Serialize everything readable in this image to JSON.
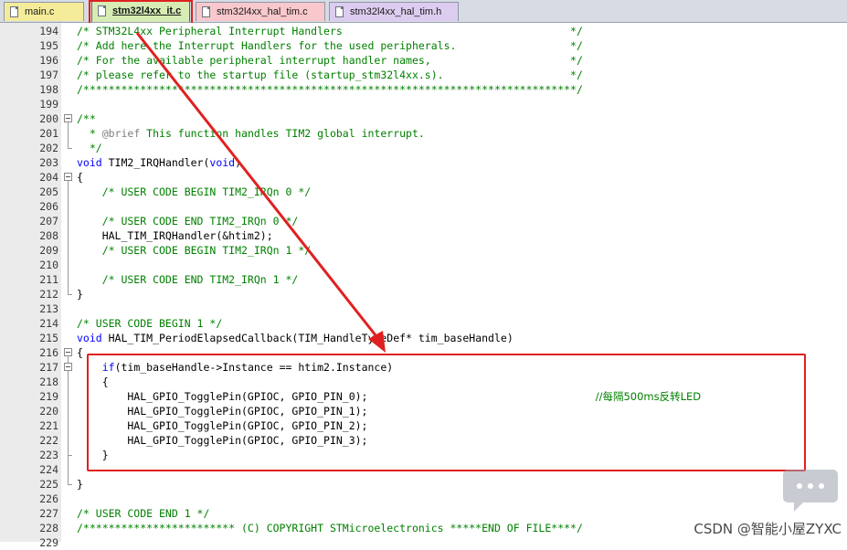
{
  "tabs": [
    {
      "label": "main.c",
      "color": "#f5ec9a",
      "active": false
    },
    {
      "label": "stm32l4xx_it.c",
      "color": "#d7ecb4",
      "active": true
    },
    {
      "label": "stm32l4xx_hal_tim.c",
      "color": "#f8c8cc",
      "active": false
    },
    {
      "label": "stm32l4xx_hal_tim.h",
      "color": "#dccdf0",
      "active": false
    }
  ],
  "lines": [
    {
      "n": "194",
      "segs": [
        {
          "t": "/* STM32L4xx Peripheral Interrupt Handlers                                    */",
          "c": "comment"
        }
      ]
    },
    {
      "n": "195",
      "segs": [
        {
          "t": "/* Add here the Interrupt Handlers for the used peripherals.                  */",
          "c": "comment"
        }
      ]
    },
    {
      "n": "196",
      "segs": [
        {
          "t": "/* For the available peripheral interrupt handler names,                      */",
          "c": "comment"
        }
      ]
    },
    {
      "n": "197",
      "segs": [
        {
          "t": "/* please refer to the startup file (startup_stm32l4xx.s).                    */",
          "c": "comment"
        }
      ]
    },
    {
      "n": "198",
      "segs": [
        {
          "t": "/******************************************************************************/",
          "c": "comment"
        }
      ]
    },
    {
      "n": "199",
      "segs": []
    },
    {
      "n": "200",
      "segs": [
        {
          "t": "/**",
          "c": "comment"
        }
      ]
    },
    {
      "n": "201",
      "segs": [
        {
          "t": "  * ",
          "c": "comment"
        },
        {
          "t": "@brief",
          "c": "brief"
        },
        {
          "t": " This function handles TIM2 global interrupt.",
          "c": "comment"
        }
      ]
    },
    {
      "n": "202",
      "segs": [
        {
          "t": "  */",
          "c": "comment"
        }
      ]
    },
    {
      "n": "203",
      "segs": [
        {
          "t": "void",
          "c": "kw"
        },
        {
          "t": " TIM2_IRQHandler(",
          "c": "plain"
        },
        {
          "t": "void",
          "c": "kw"
        },
        {
          "t": ")",
          "c": "plain"
        }
      ]
    },
    {
      "n": "204",
      "segs": [
        {
          "t": "{",
          "c": "plain"
        }
      ]
    },
    {
      "n": "205",
      "segs": [
        {
          "t": "    /* USER CODE BEGIN TIM2_IRQn 0 */",
          "c": "comment"
        }
      ]
    },
    {
      "n": "206",
      "segs": []
    },
    {
      "n": "207",
      "segs": [
        {
          "t": "    /* USER CODE END TIM2_IRQn 0 */",
          "c": "comment"
        }
      ]
    },
    {
      "n": "208",
      "segs": [
        {
          "t": "    HAL_TIM_IRQHandler(&htim2);",
          "c": "plain"
        }
      ]
    },
    {
      "n": "209",
      "segs": [
        {
          "t": "    /* USER CODE BEGIN TIM2_IRQn 1 */",
          "c": "comment"
        }
      ]
    },
    {
      "n": "210",
      "segs": []
    },
    {
      "n": "211",
      "segs": [
        {
          "t": "    /* USER CODE END TIM2_IRQn 1 */",
          "c": "comment"
        }
      ]
    },
    {
      "n": "212",
      "segs": [
        {
          "t": "}",
          "c": "plain"
        }
      ]
    },
    {
      "n": "213",
      "segs": []
    },
    {
      "n": "214",
      "segs": [
        {
          "t": "/* USER CODE BEGIN 1 */",
          "c": "comment"
        }
      ]
    },
    {
      "n": "215",
      "segs": [
        {
          "t": "void",
          "c": "kw"
        },
        {
          "t": " HAL_TIM_PeriodElapsedCallback(TIM_HandleTypeDef* tim_baseHandle)",
          "c": "plain"
        }
      ]
    },
    {
      "n": "216",
      "segs": [
        {
          "t": "{",
          "c": "plain"
        }
      ]
    },
    {
      "n": "217",
      "segs": [
        {
          "t": "    ",
          "c": "plain"
        },
        {
          "t": "if",
          "c": "kw"
        },
        {
          "t": "(tim_baseHandle->Instance == htim2.Instance)",
          "c": "plain"
        }
      ]
    },
    {
      "n": "218",
      "segs": [
        {
          "t": "    {",
          "c": "plain"
        }
      ]
    },
    {
      "n": "219",
      "segs": [
        {
          "t": "        HAL_GPIO_TogglePin(GPIOC, GPIO_PIN_0);                                    ",
          "c": "plain"
        },
        {
          "t": "//每隔500ms反转LED",
          "c": "cn"
        }
      ]
    },
    {
      "n": "220",
      "segs": [
        {
          "t": "        HAL_GPIO_TogglePin(GPIOC, GPIO_PIN_1);",
          "c": "plain"
        }
      ]
    },
    {
      "n": "221",
      "segs": [
        {
          "t": "        HAL_GPIO_TogglePin(GPIOC, GPIO_PIN_2);",
          "c": "plain"
        }
      ]
    },
    {
      "n": "222",
      "segs": [
        {
          "t": "        HAL_GPIO_TogglePin(GPIOC, GPIO_PIN_3);",
          "c": "plain"
        }
      ]
    },
    {
      "n": "223",
      "segs": [
        {
          "t": "    }",
          "c": "plain"
        }
      ]
    },
    {
      "n": "224",
      "segs": []
    },
    {
      "n": "225",
      "segs": [
        {
          "t": "}",
          "c": "plain"
        }
      ]
    },
    {
      "n": "226",
      "segs": []
    },
    {
      "n": "227",
      "segs": [
        {
          "t": "/* USER CODE END 1 */",
          "c": "comment"
        }
      ]
    },
    {
      "n": "228",
      "segs": [
        {
          "t": "/************************ (C) COPYRIGHT STMicroelectronics *****END OF FILE****/",
          "c": "comment"
        }
      ]
    },
    {
      "n": "229",
      "segs": []
    }
  ],
  "watermark": "CSDN @智能小屋ZYXC",
  "annotation_color": "#e02020"
}
